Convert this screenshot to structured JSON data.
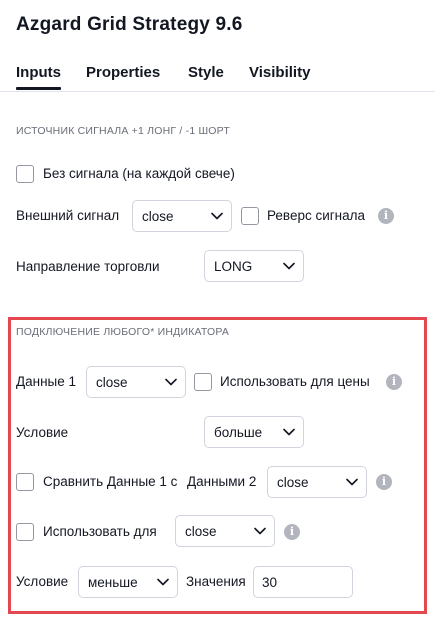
{
  "title": "Azgard Grid Strategy 9.6",
  "tabs": [
    {
      "label": "Inputs",
      "active": true
    },
    {
      "label": "Properties",
      "active": false
    },
    {
      "label": "Style",
      "active": false
    },
    {
      "label": "Visibility",
      "active": false
    }
  ],
  "signal_section": {
    "heading": "ИСТОЧНИК СИГНАЛА +1 ЛОНГ / -1 ШОРТ",
    "no_signal_label": "Без сигнала (на каждой свече)",
    "external_signal_label": "Внешний сигнал",
    "external_signal_value": "close",
    "reverse_label": "Реверс сигнала",
    "direction_label": "Направление торговли",
    "direction_value": "LONG"
  },
  "indicator_section": {
    "heading": "ПОДКЛЮЧЕНИЕ ЛЮБОГО* ИНДИКАТОРА",
    "data1_label": "Данные 1",
    "data1_value": "close",
    "use_for_price_label": "Использовать для цены",
    "condition_label": "Условие",
    "condition_value": "больше",
    "compare_label": "Сравнить Данные 1 с",
    "data2_label": "Данными 2",
    "data2_value": "close",
    "use_for_label": "Использовать для",
    "use_for_value": "close",
    "condition2_label": "Условие",
    "condition2_value": "меньше",
    "values_label": "Значения",
    "values_value": "30"
  },
  "colors": {
    "highlight_border": "#e5474e",
    "text": "#131722",
    "info_icon": "#b2b5be"
  }
}
